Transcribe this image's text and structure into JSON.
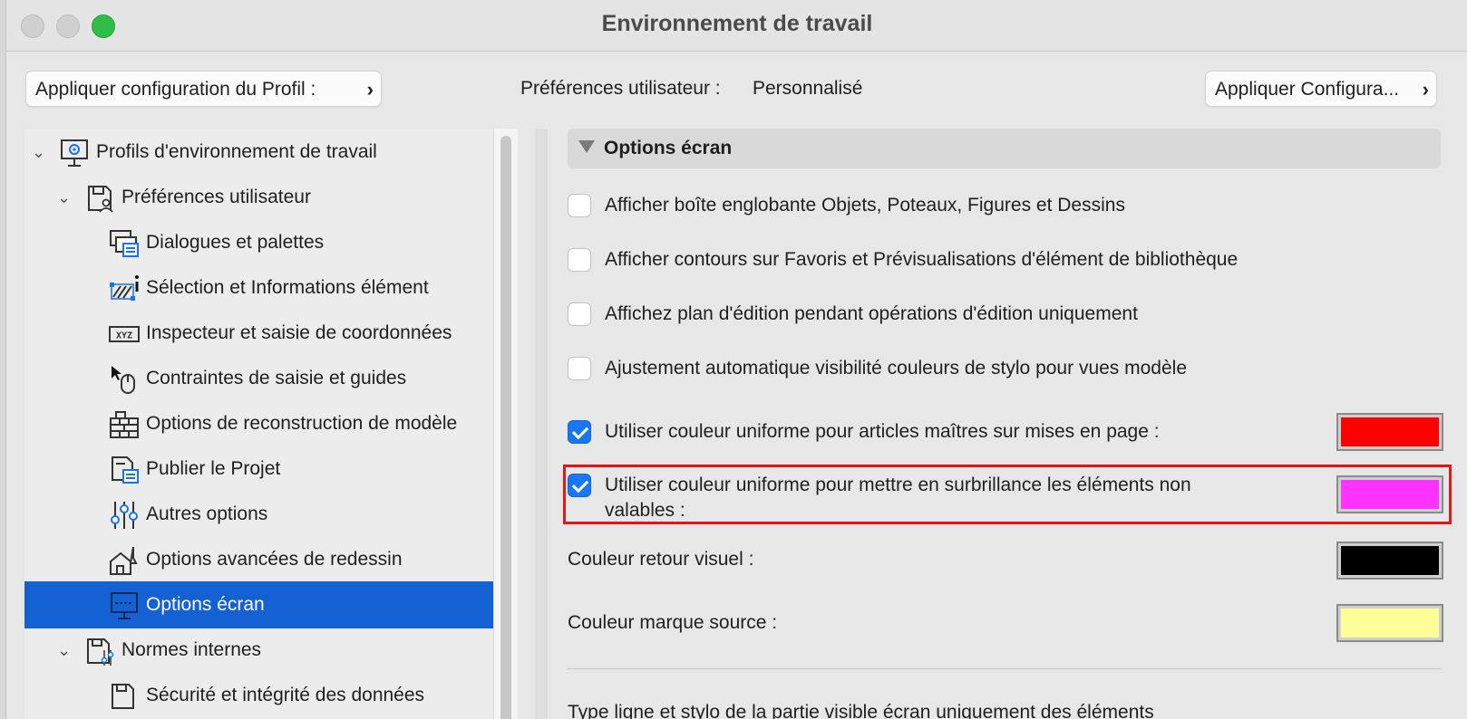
{
  "window": {
    "title": "Environnement de travail"
  },
  "toolbar": {
    "apply_profile_label": "Appliquer configuration du Profil :",
    "apply_config_label": "Appliquer Configura...",
    "prefs_label": "Préférences utilisateur :",
    "prefs_value": "Personnalisé"
  },
  "tree": {
    "items": [
      {
        "label": "Profils d'environnement de travail",
        "icon": "profile-gear-icon"
      },
      {
        "label": "Préférences utilisateur",
        "icon": "user-prefs-icon"
      },
      {
        "label": "Dialogues et palettes",
        "icon": "dialogs-palettes-icon"
      },
      {
        "label": "Sélection et Informations élément",
        "icon": "selection-info-icon"
      },
      {
        "label": "Inspecteur et saisie de coordonnées",
        "icon": "xyz-coordinates-icon"
      },
      {
        "label": "Contraintes de saisie et guides",
        "icon": "cursor-mouse-icon"
      },
      {
        "label": "Options de reconstruction de modèle",
        "icon": "brick-wall-icon"
      },
      {
        "label": "Publier le Projet",
        "icon": "publish-project-icon"
      },
      {
        "label": "Autres options",
        "icon": "sliders-icon"
      },
      {
        "label": "Options avancées de redessin",
        "icon": "redraw-house-icon"
      },
      {
        "label": "Options écran",
        "icon": "monitor-icon"
      },
      {
        "label": "Normes internes",
        "icon": "internal-standards-icon"
      },
      {
        "label": "Sécurité et intégrité des données",
        "icon": "data-security-icon"
      }
    ]
  },
  "content": {
    "section_title": "Options écran",
    "options": [
      {
        "label": "Afficher boîte englobante Objets, Poteaux, Figures et Dessins",
        "checked": false
      },
      {
        "label": "Afficher contours sur Favoris et Prévisualisations d'élément de bibliothèque",
        "checked": false
      },
      {
        "label": "Affichez plan d'édition pendant opérations d'édition uniquement",
        "checked": false
      },
      {
        "label": "Ajustement automatique visibilité couleurs de stylo pour vues modèle",
        "checked": false
      },
      {
        "label": "Utiliser couleur uniforme pour articles maîtres sur mises en page :",
        "checked": true
      },
      {
        "label_line1": "Utiliser couleur uniforme pour mettre en surbrillance les éléments non",
        "label_line2": "valables :",
        "checked": true
      }
    ],
    "color_feedback_label": "Couleur retour visuel :",
    "color_source_label": "Couleur marque source :",
    "colors": {
      "master_items": "#ff0000",
      "invalid_highlight": "#ff33ff",
      "feedback": "#000000",
      "source_mark": "#ffff99"
    },
    "bottom_text": "Type ligne et stylo de la partie visible écran uniquement des éléments"
  }
}
